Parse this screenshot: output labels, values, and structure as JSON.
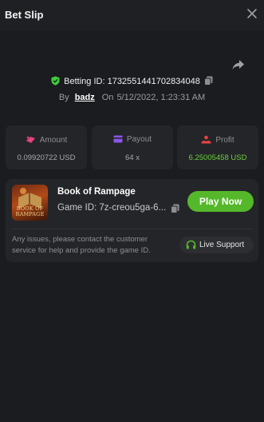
{
  "header": {
    "title": "Bet Slip"
  },
  "bet": {
    "betting_id_label": "Betting ID:",
    "betting_id": "1732551441702834048",
    "by_label": "By",
    "user": "badz",
    "on_label": "On",
    "date": "5/12/2022, 1:23:31 AM"
  },
  "stats": {
    "amount": {
      "label": "Amount",
      "value": "0.09920722 USD"
    },
    "payout": {
      "label": "Payout",
      "value": "64 x"
    },
    "profit": {
      "label": "Profit",
      "value": "6.25005458 USD"
    }
  },
  "game": {
    "name": "Book of Rampage",
    "id_text": "Game ID: 7z-creou5ga-6...",
    "thumb_text": "BOOK OF RAMPAGE",
    "play_label": "Play Now"
  },
  "support": {
    "help_text": "Any issues, please contact the customer service for help and provide the game ID.",
    "live_label": "Live Support"
  },
  "colors": {
    "accent_green": "#55b82a",
    "profit_green": "#6ccf3c",
    "shield_green": "#3ecb3e",
    "amount_pink": "#e2457a",
    "payout_purple": "#8a56e8",
    "profit_red": "#e84343"
  }
}
